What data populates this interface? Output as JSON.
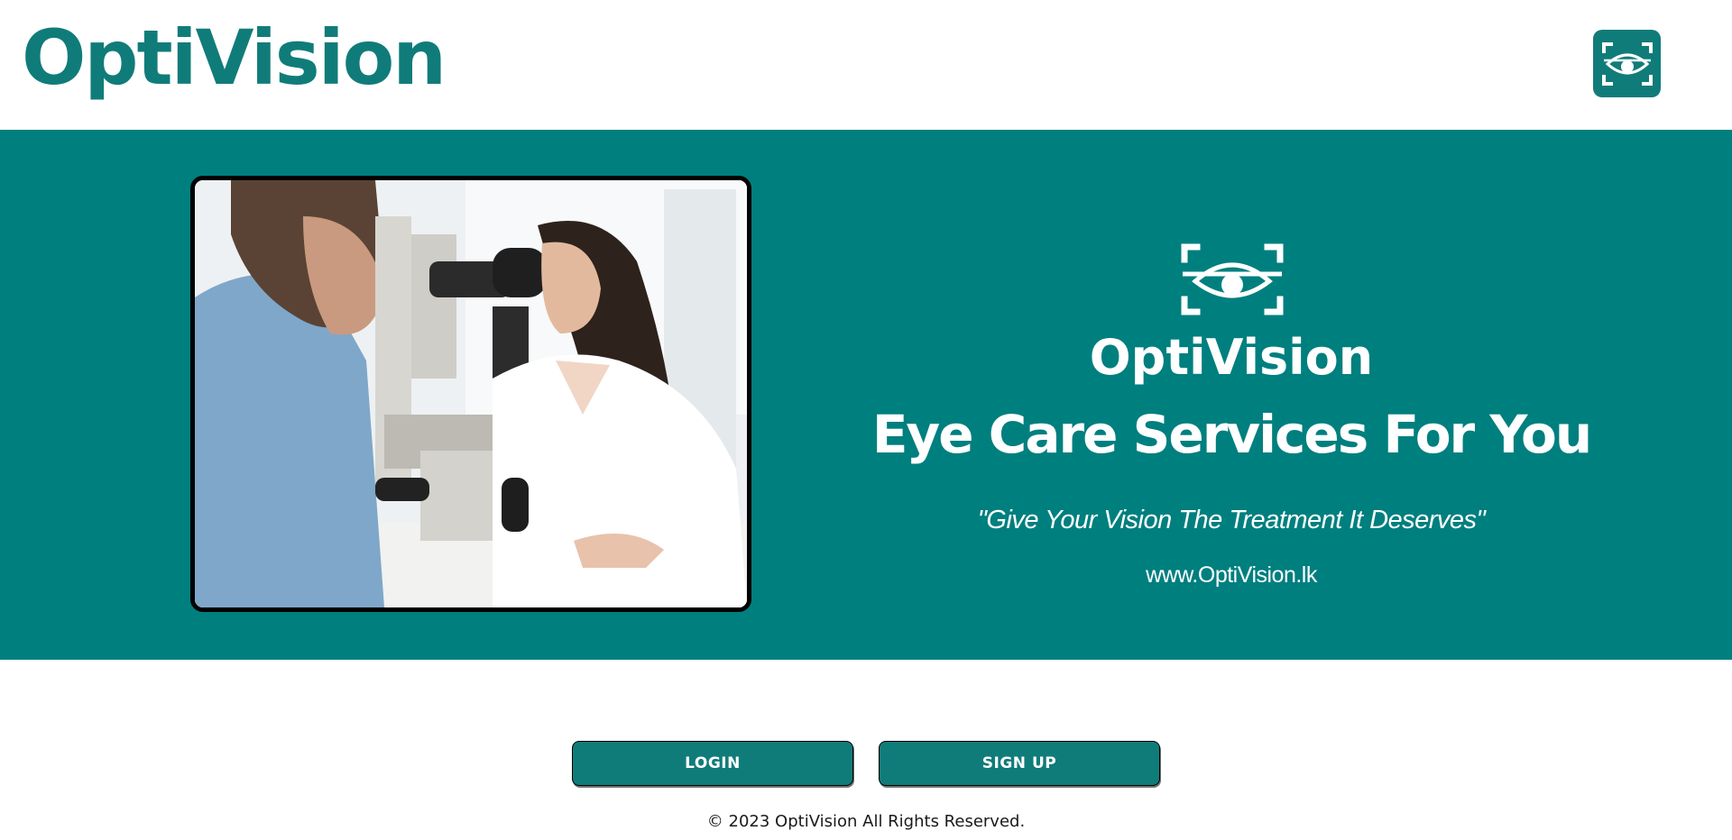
{
  "header": {
    "brand": "OptiVision",
    "icon": "eye-scan-icon"
  },
  "hero": {
    "photo": "eye-exam-photo",
    "logo_icon": "eye-scan-icon",
    "brand": "OptiVision",
    "headline": "Eye Care Services For You",
    "quote": "\"Give Your Vision The Treatment It Deserves\"",
    "url": "www.OptiVision.lk"
  },
  "actions": {
    "login_label": "LOGIN",
    "signup_label": "SIGN UP"
  },
  "footer": {
    "copyright": "© 2023 OptiVision All Rights Reserved."
  },
  "colors": {
    "brand_teal": "#107c7a",
    "hero_background": "#007f7f",
    "text_on_teal": "#ffffff"
  }
}
